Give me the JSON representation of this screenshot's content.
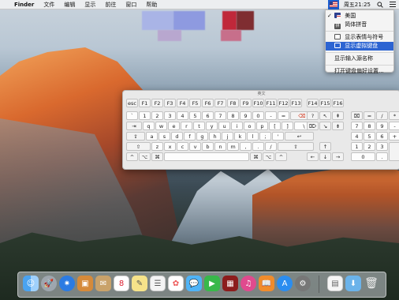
{
  "menubar": {
    "apple": "",
    "items": [
      "Finder",
      "文件",
      "编辑",
      "显示",
      "前往",
      "窗口",
      "帮助"
    ],
    "clock": "周五21:25"
  },
  "input_menu": {
    "items": [
      {
        "label": "美国",
        "checked": true,
        "icon": "us-flag-icon"
      },
      {
        "label": "简体拼音",
        "checked": false,
        "icon": "pinyin-icon"
      }
    ],
    "actions": [
      {
        "label": "显示表情与符号",
        "icon": "emoji-viewer-icon"
      },
      {
        "label": "显示虚拟键盘",
        "icon": "keyboard-viewer-icon",
        "selected": true
      }
    ],
    "show_name": "显示输入源名称",
    "open_prefs": "打开键盘偏好设置..."
  },
  "keyboard_viewer": {
    "title": "英文",
    "fn_row": [
      "esc",
      "F1",
      "F2",
      "F3",
      "F4",
      "F5",
      "F6",
      "F7",
      "F8",
      "F9",
      "F10",
      "F11",
      "F12",
      "F13"
    ],
    "fn_right": [
      "F14",
      "F15",
      "F16"
    ],
    "row1": [
      "`",
      "1",
      "2",
      "3",
      "4",
      "5",
      "6",
      "7",
      "8",
      "9",
      "0",
      "-",
      "=",
      "⌫"
    ],
    "row2": [
      "⇥",
      "q",
      "w",
      "e",
      "r",
      "t",
      "y",
      "u",
      "i",
      "o",
      "p",
      "[",
      "]",
      "\\"
    ],
    "row3": [
      "⇪",
      "a",
      "s",
      "d",
      "f",
      "g",
      "h",
      "j",
      "k",
      "l",
      ";",
      "'",
      "↩"
    ],
    "row4": [
      "⇧",
      "z",
      "x",
      "c",
      "v",
      "b",
      "n",
      "m",
      ",",
      ".",
      "/",
      "⇧"
    ],
    "row5_left": [
      "^",
      "⌥",
      "⌘"
    ],
    "row5_right": [
      "⌘",
      "⌥",
      "^"
    ],
    "nav": [
      [
        "?",
        "↖",
        "⇞"
      ],
      [
        "⌦",
        "↘",
        "⇟"
      ]
    ],
    "arrows": [
      "↑",
      "←",
      "↓",
      "→"
    ],
    "numpad": [
      [
        "⌧",
        "=",
        "/",
        "*"
      ],
      [
        "7",
        "8",
        "9",
        "-"
      ],
      [
        "4",
        "5",
        "6",
        "+"
      ],
      [
        "1",
        "2",
        "3"
      ],
      [
        "0",
        "."
      ]
    ]
  }
}
